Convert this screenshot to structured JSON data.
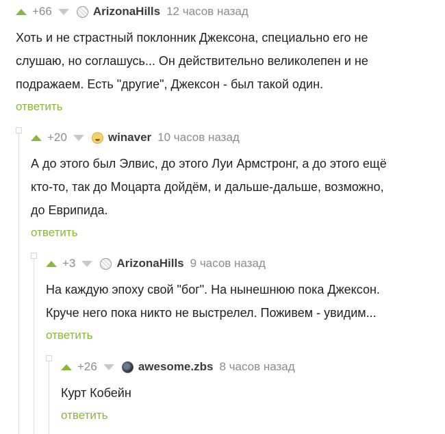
{
  "comments": [
    {
      "rating": "+66",
      "username": "ArizonaHills",
      "time": "12 часов назад",
      "text_lines": [
        "Хоть и не страстный поклонник Джексона, специально его не",
        "слушаю, но соглашусь... Он действительно великолепен и не",
        "подражаем. Есть \"другие\", Джексон - был такой один."
      ],
      "reply": "ответить"
    },
    {
      "rating": "+20",
      "username": "winaver",
      "time": "10 часов назад",
      "text_lines": [
        "А до этого был Элвис, до этого Луи Армстронг, а до этого ещё",
        "кто-то, так до Моцарта дойдём, и дальше-дальше, возможно,",
        "до Еврипида."
      ],
      "reply": "ответить"
    },
    {
      "rating": "+3",
      "username": "ArizonaHills",
      "time": "9 часов назад",
      "text_lines": [
        "На каждую эпоху свой \"бог\". На нынешнюю пока Джексон.",
        "Круче него пока никто не выстрелел. Поживем - увидим..."
      ],
      "reply": "ответить"
    },
    {
      "rating": "+26",
      "username": "awesome.zbs",
      "time": "8 часов назад",
      "text_lines": [
        "Курт Кобейн"
      ],
      "reply": "ответить"
    }
  ],
  "colors": {
    "accent_green": "#8ab73a",
    "muted_gray": "#8c8c8c",
    "text": "#222222"
  }
}
